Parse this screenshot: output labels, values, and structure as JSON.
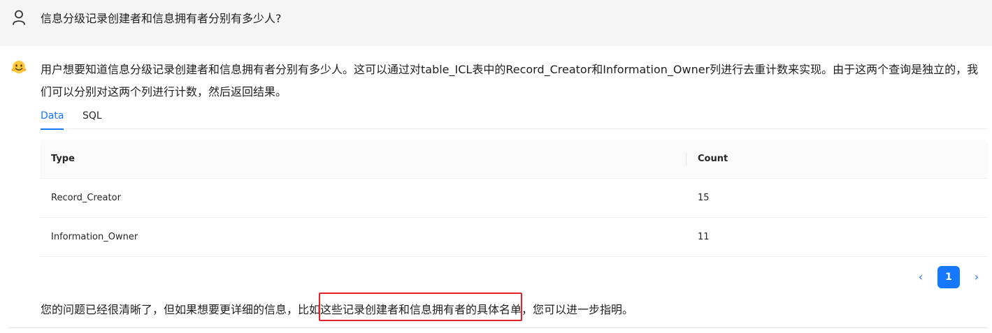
{
  "question": {
    "icon": "user-icon",
    "text": "信息分级记录创建者和信息拥有者分别有多少人?"
  },
  "answer": {
    "icon": "bot-emoji-icon",
    "text": "用户想要知道信息分级记录创建者和信息拥有者分别有多少人。这可以通过对table_ICL表中的Record_Creator和Information_Owner列进行去重计数来实现。由于这两个查询是独立的，我们可以分别对这两个列进行计数，然后返回结果。",
    "tabs": [
      {
        "label": "Data",
        "active": true
      },
      {
        "label": "SQL",
        "active": false
      }
    ],
    "table": {
      "columns": [
        "Type",
        "Count"
      ],
      "rows": [
        {
          "type": "Record_Creator",
          "count": "15"
        },
        {
          "type": "Information_Owner",
          "count": "11"
        }
      ]
    },
    "pagination": {
      "prev": "‹",
      "current_page": "1",
      "next": "›"
    },
    "followup": "您的问题已经很清晰了，但如果想要更详细的信息，比如这些记录创建者和信息拥有者的具体名单，您可以进一步指明。"
  },
  "colors": {
    "accent": "#1677ff",
    "question_bg": "#f5f5f5",
    "highlight_border": "#e8202a"
  }
}
